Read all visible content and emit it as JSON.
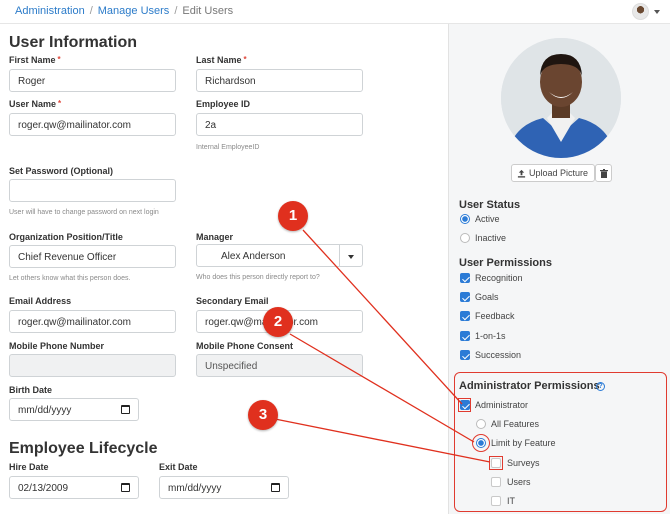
{
  "breadcrumb": {
    "item1": "Administration",
    "item2": "Manage Users",
    "current": "Edit Users",
    "separator": "/"
  },
  "colors": {
    "link": "#2b7bc9",
    "accent": "#2b7bd6",
    "callout": "#e0301e",
    "required": "#e0473b"
  },
  "user_info": {
    "title": "User Information",
    "first_name": {
      "label": "First Name",
      "required": "*",
      "value": "Roger"
    },
    "last_name": {
      "label": "Last Name",
      "required": "*",
      "value": "Richardson"
    },
    "user_name": {
      "label": "User Name",
      "required": "*",
      "value": "roger.qw@mailinator.com"
    },
    "employee_id": {
      "label": "Employee ID",
      "value": "2a",
      "help": "Internal EmployeeID"
    },
    "set_password": {
      "label": "Set Password (Optional)",
      "value": "",
      "help": "User will have to change password on next login"
    },
    "position": {
      "label": "Organization Position/Title",
      "value": "Chief Revenue Officer",
      "help": "Let others know what this person does."
    },
    "manager": {
      "label": "Manager",
      "value": "Alex Anderson",
      "help": "Who does this person directly report to?"
    },
    "email": {
      "label": "Email Address",
      "value": "roger.qw@mailinator.com"
    },
    "secondary_email": {
      "label": "Secondary Email",
      "value": "roger.qw@mailinator.com"
    },
    "mobile_phone": {
      "label": "Mobile Phone Number",
      "value": ""
    },
    "mobile_consent": {
      "label": "Mobile Phone Consent",
      "value": "Unspecified"
    },
    "birth_date": {
      "label": "Birth Date",
      "value": "mm/dd/yyyy"
    }
  },
  "lifecycle": {
    "title": "Employee Lifecycle",
    "hire_date": {
      "label": "Hire Date",
      "value": "02/13/2009"
    },
    "exit_date": {
      "label": "Exit Date",
      "value": "mm/dd/yyyy"
    }
  },
  "sidebar": {
    "upload_label": "Upload Picture",
    "user_status": {
      "title": "User Status",
      "options": [
        "Active",
        "Inactive"
      ],
      "selected": "Active"
    },
    "user_permissions": {
      "title": "User Permissions",
      "items": [
        {
          "label": "Recognition",
          "checked": true
        },
        {
          "label": "Goals",
          "checked": true
        },
        {
          "label": "Feedback",
          "checked": true
        },
        {
          "label": "1-on-1s",
          "checked": true
        },
        {
          "label": "Succession",
          "checked": true
        }
      ]
    },
    "admin_permissions": {
      "title": "Administrator Permissions",
      "info": "?",
      "administrator": {
        "label": "Administrator",
        "checked": true
      },
      "scope_options": [
        "All Features",
        "Limit by Feature"
      ],
      "scope_selected": "Limit by Feature",
      "features": [
        {
          "label": "Surveys",
          "checked": false
        },
        {
          "label": "Users",
          "checked": false
        },
        {
          "label": "IT",
          "checked": false
        }
      ]
    }
  },
  "callouts": [
    "1",
    "2",
    "3"
  ]
}
